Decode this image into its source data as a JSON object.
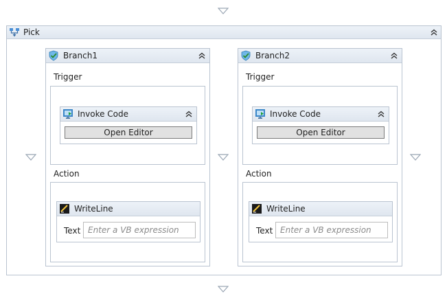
{
  "pick": {
    "title": "Pick"
  },
  "branches": [
    {
      "title": "Branch1",
      "trigger_label": "Trigger",
      "trigger_activity": {
        "title": "Invoke Code",
        "button_label": "Open Editor"
      },
      "action_label": "Action",
      "action_activity": {
        "title": "WriteLine",
        "field_label": "Text",
        "field_placeholder": "Enter a VB expression"
      }
    },
    {
      "title": "Branch2",
      "trigger_label": "Trigger",
      "trigger_activity": {
        "title": "Invoke Code",
        "button_label": "Open Editor"
      },
      "action_label": "Action",
      "action_activity": {
        "title": "WriteLine",
        "field_label": "Text",
        "field_placeholder": "Enter a VB expression"
      }
    }
  ],
  "icons": {
    "drop_target": "triangle-down-icon",
    "collapse": "double-chevron-up-icon",
    "pick": "pick-activity-icon",
    "branch": "branch-activity-icon",
    "invoke_code": "invoke-code-icon",
    "write_line": "writeline-icon"
  },
  "colors": {
    "frame_border": "#b9c3d0",
    "header_bg": "#e4eaf2",
    "drop_arrow": "#9aa6b4"
  }
}
